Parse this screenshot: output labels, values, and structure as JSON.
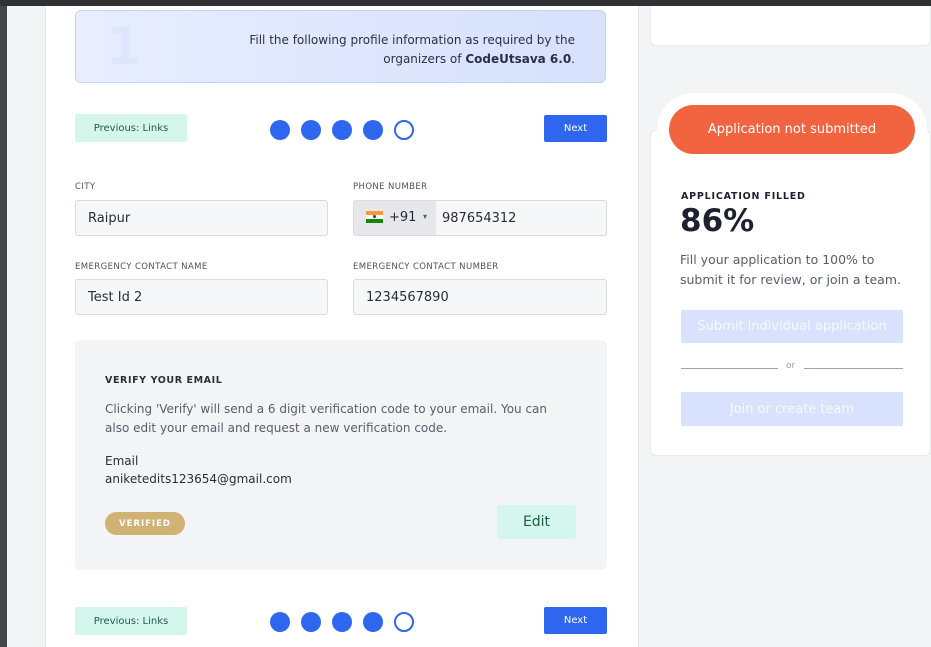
{
  "banner": {
    "step_number": "1",
    "text_before": "Fill the following profile information as required by the organizers of ",
    "event_name": "CodeUtsava 6.0",
    "text_after": "."
  },
  "stepper": {
    "previous_label": "Previous: Links",
    "next_label": "Next",
    "total_steps": 5,
    "completed_steps": 4
  },
  "form": {
    "city_label": "CITY",
    "city_value": "Raipur",
    "phone_label": "PHONE NUMBER",
    "phone_dial_code": "+91",
    "phone_country_icon": "india-flag-icon",
    "phone_value": "987654312",
    "emergency_name_label": "EMERGENCY CONTACT NAME",
    "emergency_name_value": "Test Id 2",
    "emergency_number_label": "EMERGENCY CONTACT NUMBER",
    "emergency_number_value": "1234567890"
  },
  "verify": {
    "title": "VERIFY YOUR EMAIL",
    "description": "Clicking 'Verify' will send a 6 digit verification code to your email. You can also edit your email and request a new verification code.",
    "email_label": "Email",
    "email_value": "aniketedits123654@gmail.com",
    "status_badge": "VERIFIED",
    "edit_label": "Edit"
  },
  "sidebar": {
    "status": "Application not submitted",
    "filled_label": "APPLICATION FILLED",
    "filled_percent": "86%",
    "filled_desc": "Fill your application to 100% to submit it for review, or join a team.",
    "submit_label": "Submit individual application",
    "or_label": "or",
    "join_label": "Join or create team"
  },
  "colors": {
    "accent": "#2f66f0",
    "status": "#f2643f",
    "badge": "#cfb274",
    "mint": "#d5f6ec"
  }
}
